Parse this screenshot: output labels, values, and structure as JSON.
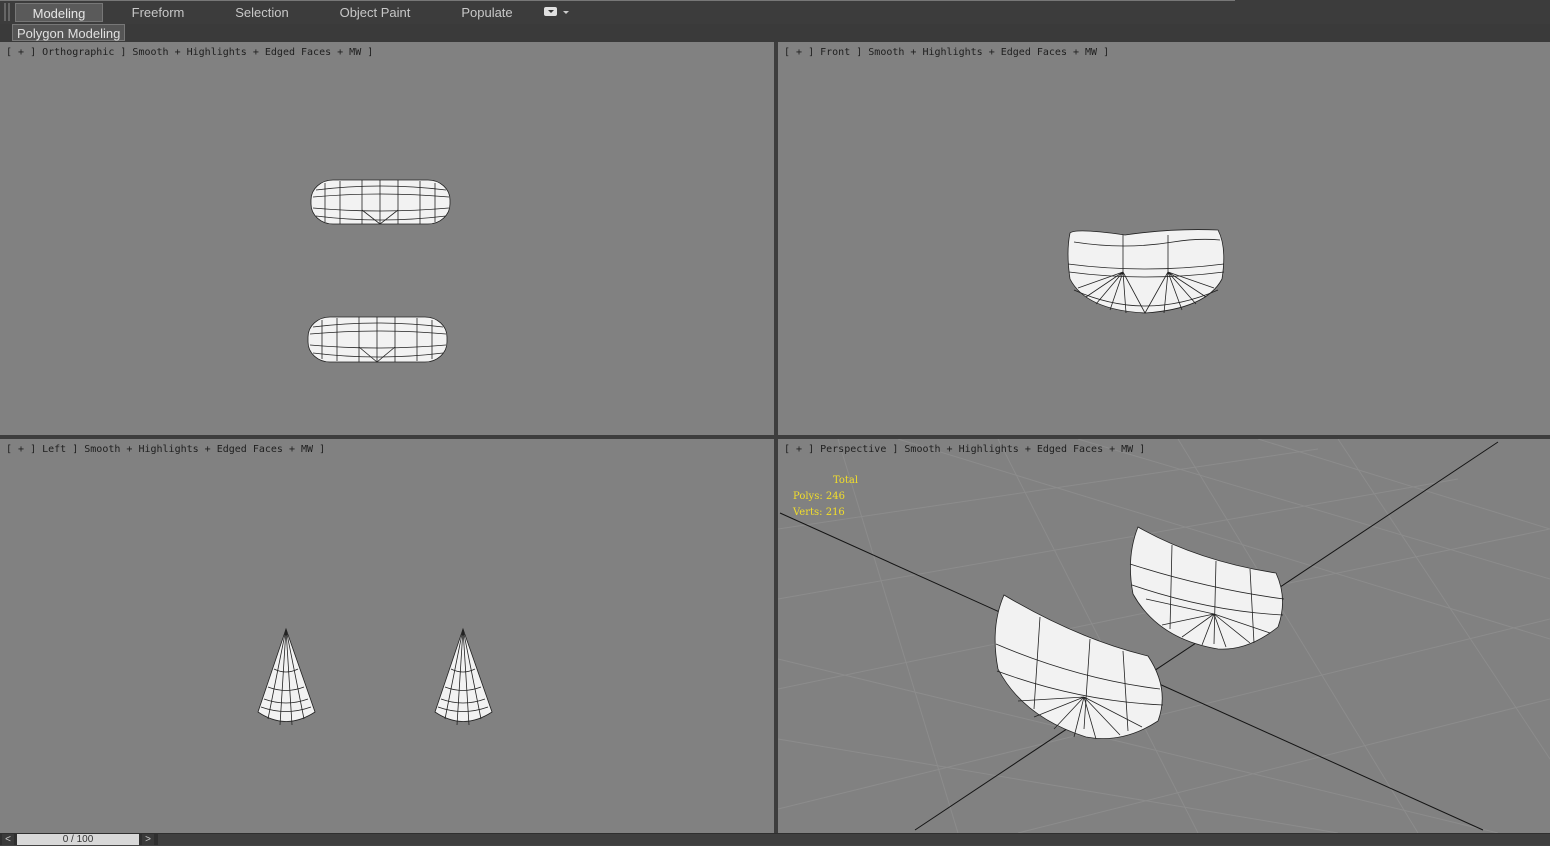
{
  "ribbon": {
    "tabs": [
      {
        "label": "Modeling",
        "active": true
      },
      {
        "label": "Freeform",
        "active": false
      },
      {
        "label": "Selection",
        "active": false
      },
      {
        "label": "Object Paint",
        "active": false
      },
      {
        "label": "Populate",
        "active": false
      }
    ],
    "dropdown_icon": "ribbon-options-icon",
    "subtab_label": "Polygon Modeling"
  },
  "viewports": {
    "top_left": {
      "label": "[ + ] Orthographic ] Smooth + Highlights + Edged Faces + MW ]"
    },
    "top_right": {
      "label": "[ + ] Front ] Smooth + Highlights + Edged Faces + MW ]"
    },
    "bottom_left": {
      "label": "[ + ] Left ] Smooth + Highlights + Edged Faces + MW ]"
    },
    "bottom_right": {
      "label": "[ + ] Perspective ] Smooth + Highlights + Edged Faces + MW ]",
      "stats": {
        "total_label": "Total",
        "polys": "Polys: 246",
        "verts": "Verts: 216"
      }
    }
  },
  "timeline": {
    "prev": "<",
    "next": ">",
    "frame": "0 / 100"
  },
  "colors": {
    "viewport_bg": "#818181",
    "stats_text": "#f2de2a",
    "ui_dark": "#3c3c3c"
  }
}
